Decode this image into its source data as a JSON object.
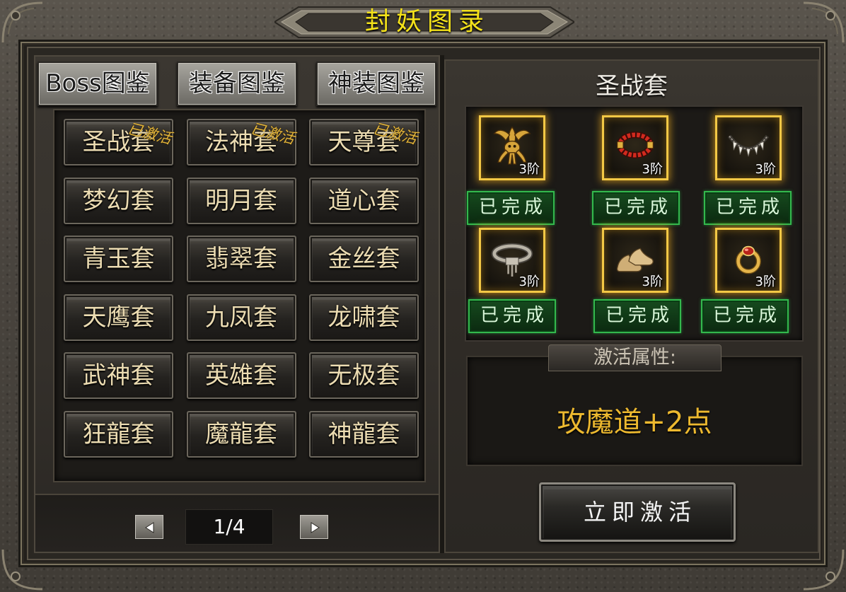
{
  "window": {
    "title": "封妖图录"
  },
  "tabs": [
    {
      "label": "Boss图鉴"
    },
    {
      "label": "装备图鉴"
    },
    {
      "label": "神装图鉴"
    }
  ],
  "sets": [
    {
      "name": "圣战套",
      "badge": "已激活"
    },
    {
      "name": "法神套",
      "badge": "已激活"
    },
    {
      "name": "天尊套",
      "badge": "已激活"
    },
    {
      "name": "梦幻套"
    },
    {
      "name": "明月套"
    },
    {
      "name": "道心套"
    },
    {
      "name": "青玉套"
    },
    {
      "name": "翡翠套"
    },
    {
      "name": "金丝套"
    },
    {
      "name": "天鹰套"
    },
    {
      "name": "九凤套"
    },
    {
      "name": "龙啸套"
    },
    {
      "name": "武神套"
    },
    {
      "name": "英雄套"
    },
    {
      "name": "无极套"
    },
    {
      "name": "狂龍套"
    },
    {
      "name": "魔龍套"
    },
    {
      "name": "神龍套"
    }
  ],
  "pagination": {
    "page": "1/4",
    "prev_icon": "triangle-left-icon",
    "next_icon": "triangle-right-icon"
  },
  "detail": {
    "title": "圣战套",
    "pieces": [
      {
        "icon": "helmet-icon",
        "tier": "3阶",
        "status": "已完成"
      },
      {
        "icon": "bracelet-icon",
        "tier": "3阶",
        "status": "已完成"
      },
      {
        "icon": "necklace-icon",
        "tier": "3阶",
        "status": "已完成"
      },
      {
        "icon": "belt-icon",
        "tier": "3阶",
        "status": "已完成"
      },
      {
        "icon": "boots-icon",
        "tier": "3阶",
        "status": "已完成"
      },
      {
        "icon": "ring-icon",
        "tier": "3阶",
        "status": "已完成"
      }
    ],
    "attr_label": "激活属性:",
    "attr_value": "攻魔道+2点",
    "activate_label": "立即激活"
  },
  "colors": {
    "title": "#f4e21a",
    "set_text": "#ecdcb2",
    "activated_badge": "#e3b53a",
    "slot_glow": "#f3c845",
    "completed_border": "#33b84d",
    "attr_value": "#edb92f"
  }
}
